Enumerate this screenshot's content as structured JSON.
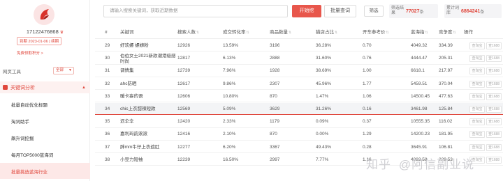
{
  "sidebar": {
    "user_phone": "17122476868",
    "crown_glyph": "♛",
    "expire_text": "到期 2023-01-06 | 续期",
    "trial_link": "免费领取积分 >",
    "web_label": "网页工具",
    "web_select": "全部",
    "section_label": "关键词分析",
    "items": [
      {
        "label": "批量自动优化标题",
        "active": false
      },
      {
        "label": "淘词助手",
        "active": false
      },
      {
        "label": "飙升词挖掘",
        "active": false
      },
      {
        "label": "每月TOP5000蓝海词",
        "active": false
      },
      {
        "label": "批量挑选蓝海行业",
        "active": true
      }
    ]
  },
  "topbar": {
    "search_placeholder": "请输入搜索关键词，获取近期数据",
    "start_button": "开始挖",
    "batch_button": "批量查词",
    "filter_button": "筛选",
    "filter_result_label": "筛选结果",
    "filter_result_value": "77027",
    "filter_result_unit": "条",
    "total_label": "累计词库",
    "total_value": "6864241",
    "total_unit": "条"
  },
  "table": {
    "headers": [
      "#",
      "关键词",
      "搜索人数",
      "成交转化率",
      "商品数量",
      "猫店占比",
      "开车参考价",
      "蓝海指",
      "竞争度",
      "操作"
    ],
    "op_buttons": [
      "查淘宝",
      "查1688"
    ],
    "rows": [
      {
        "idx": "29",
        "kw": "好欢螺 螺蛳粉",
        "search": "12926",
        "conv": "13.59%",
        "goods": "3196",
        "tmall": "36.28%",
        "cpc": "0.70",
        "blue": "4049.32",
        "comp": "334.39",
        "highlight": false
      },
      {
        "idx": "30",
        "kw": "伯伯女士2021新款潮港级感时尚",
        "search": "12817",
        "conv": "6.13%",
        "goods": "2888",
        "tmall": "31.60%",
        "cpc": "0.76",
        "blue": "4444.47",
        "comp": "205.31",
        "highlight": false
      },
      {
        "idx": "31",
        "kw": "调情集",
        "search": "12739",
        "conv": "7.96%",
        "goods": "1928",
        "tmall": "38.69%",
        "cpc": "1.00",
        "blue": "6618.1",
        "comp": "217.97",
        "highlight": false
      },
      {
        "idx": "32",
        "kw": "ahc防晒",
        "search": "12617",
        "conv": "9.86%",
        "goods": "2307",
        "tmall": "45.96%",
        "cpc": "1.77",
        "blue": "5459.51",
        "comp": "370.04",
        "highlight": false
      },
      {
        "idx": "33",
        "kw": "暖卡妄的语",
        "search": "12606",
        "conv": "10.80%",
        "goods": "870",
        "tmall": "1.47%",
        "cpc": "1.06",
        "blue": "14500.45",
        "comp": "477.63",
        "highlight": false
      },
      {
        "idx": "34",
        "kw": "chic上衣甜辣短款",
        "search": "12569",
        "conv": "5.09%",
        "goods": "3629",
        "tmall": "31.26%",
        "cpc": "0.16",
        "blue": "3461.98",
        "comp": "125.84",
        "highlight": true
      },
      {
        "idx": "35",
        "kw": "迟伞伞",
        "search": "12420",
        "conv": "2.33%",
        "goods": "1179",
        "tmall": "0.09%",
        "cpc": "0.37",
        "blue": "10555.35",
        "comp": "116.02",
        "highlight": false
      },
      {
        "idx": "36",
        "kw": "嘉利玛韵滚滚",
        "search": "12416",
        "conv": "2.10%",
        "goods": "870",
        "tmall": "0.00%",
        "cpc": "1.29",
        "blue": "14200.23",
        "comp": "181.95",
        "highlight": false
      },
      {
        "idx": "37",
        "kw": "胖mm牛仔上衣遮肚",
        "search": "12277",
        "conv": "6.20%",
        "goods": "3367",
        "tmall": "49.43%",
        "cpc": "0.28",
        "blue": "3645.91",
        "comp": "106.81",
        "highlight": false
      },
      {
        "idx": "38",
        "kw": "小豆力短袖",
        "search": "12239",
        "conv": "16.50%",
        "goods": "2997",
        "tmall": "7.77%",
        "cpc": "1.16",
        "blue": "4083.58",
        "comp": "229.53",
        "highlight": false
      }
    ]
  },
  "watermark": {
    "site": "知乎",
    "author": "@阿信副业说"
  },
  "colors": {
    "accent": "#e8564b",
    "highlight_line": "#e0473c"
  }
}
